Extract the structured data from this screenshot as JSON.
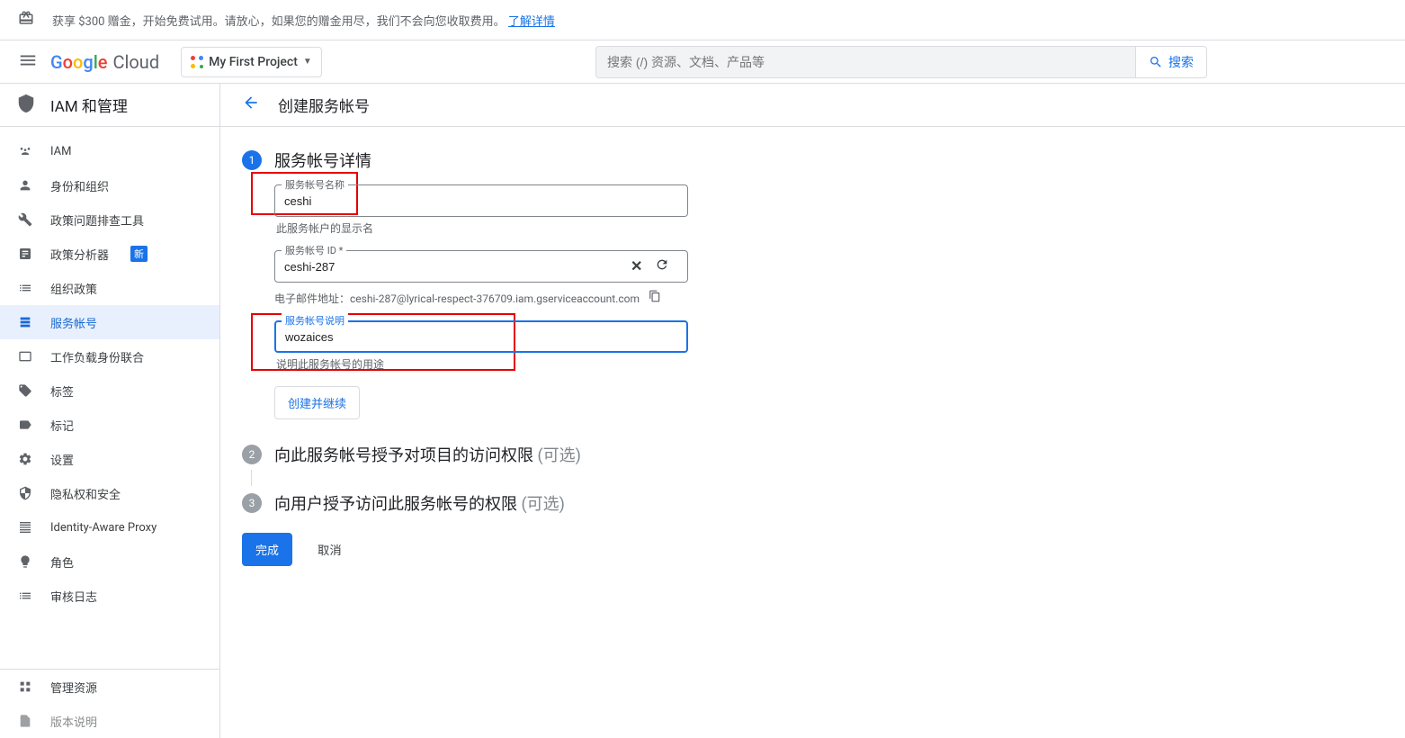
{
  "promo": {
    "text": "获享 $300 赠金，开始免费试用。请放心，如果您的赠金用尽，我们不会向您收取费用。",
    "link": "了解详情"
  },
  "header": {
    "logo_cloud": "Cloud",
    "project_name": "My First Project",
    "search_placeholder": "搜索 (/) 资源、文档、产品等",
    "search_button": "搜索"
  },
  "sidebar": {
    "title": "IAM 和管理",
    "items": [
      {
        "label": "IAM"
      },
      {
        "label": "身份和组织"
      },
      {
        "label": "政策问题排查工具"
      },
      {
        "label": "政策分析器",
        "badge": "新"
      },
      {
        "label": "组织政策"
      },
      {
        "label": "服务帐号"
      },
      {
        "label": "工作负载身份联合"
      },
      {
        "label": "标签"
      },
      {
        "label": "标记"
      },
      {
        "label": "设置"
      },
      {
        "label": "隐私权和安全"
      },
      {
        "label": "Identity-Aware Proxy"
      },
      {
        "label": "角色"
      },
      {
        "label": "审核日志"
      }
    ],
    "footer_item": "管理资源",
    "bottom_frag": "版本说明"
  },
  "page": {
    "title": "创建服务帐号"
  },
  "form": {
    "step1_title": "服务帐号详情",
    "name_label": "服务帐号名称",
    "name_value": "ceshi",
    "name_helper": "此服务帐户的显示名",
    "id_label": "服务帐号 ID *",
    "id_value": "ceshi-287",
    "email_label": "电子邮件地址：",
    "email_value": "ceshi-287@lyrical-respect-376709.iam.gserviceaccount.com",
    "desc_label": "服务帐号说明",
    "desc_value": "wozaices",
    "desc_helper": "说明此服务帐号的用途",
    "create_continue": "创建并继续",
    "step2_title": "向此服务帐号授予对项目的访问权限",
    "step2_optional": "(可选)",
    "step3_title": "向用户授予访问此服务帐号的权限",
    "step3_optional": "(可选)",
    "done": "完成",
    "cancel": "取消"
  }
}
